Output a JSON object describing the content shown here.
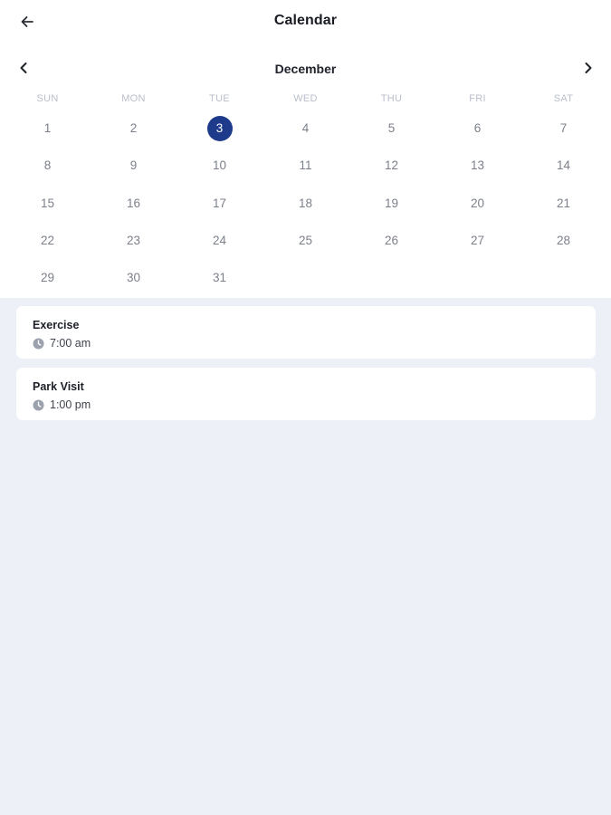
{
  "header": {
    "title": "Calendar",
    "back_icon": "arrow-left-icon"
  },
  "calendar": {
    "month": "December",
    "prev_icon": "chevron-left-icon",
    "next_icon": "chevron-right-icon",
    "weekdays": [
      "SUN",
      "MON",
      "TUE",
      "WED",
      "THU",
      "FRI",
      "SAT"
    ],
    "days": [
      "1",
      "2",
      "3",
      "4",
      "5",
      "6",
      "7",
      "8",
      "9",
      "10",
      "11",
      "12",
      "13",
      "14",
      "15",
      "16",
      "17",
      "18",
      "19",
      "20",
      "21",
      "22",
      "23",
      "24",
      "25",
      "26",
      "27",
      "28",
      "29",
      "30",
      "31"
    ],
    "selected_day": "3",
    "selected_color": "#1e3a8a"
  },
  "events": [
    {
      "title": "Exercise",
      "time": "7:00 am",
      "icon": "clock-icon"
    },
    {
      "title": "Park Visit",
      "time": "1:00 pm",
      "icon": "clock-icon"
    }
  ]
}
